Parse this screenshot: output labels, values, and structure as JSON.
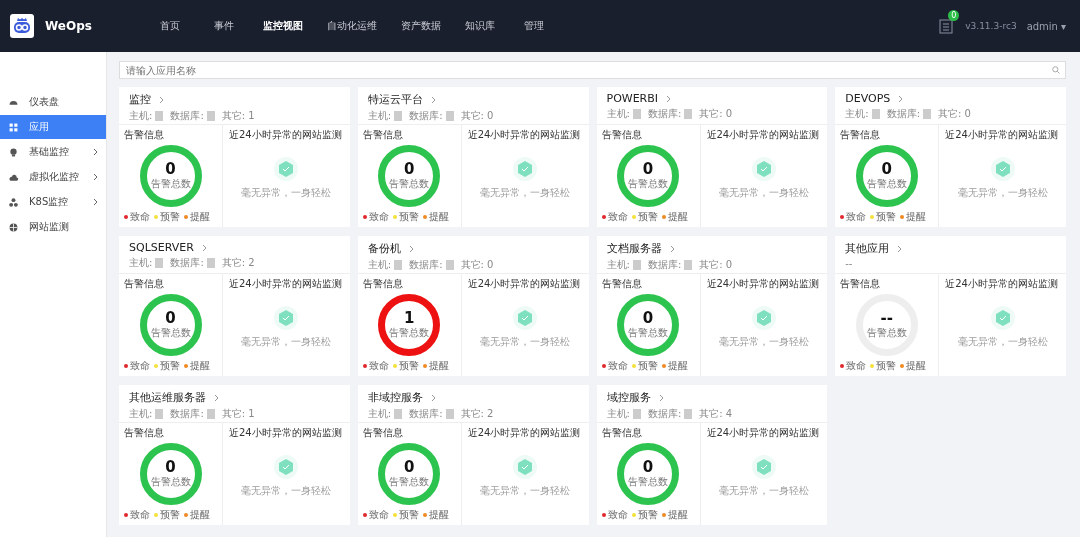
{
  "header": {
    "logo_text": "WeOps",
    "nav": [
      {
        "label": "首页",
        "selected": false
      },
      {
        "label": "事件",
        "selected": false
      },
      {
        "label": "监控视图",
        "selected": true
      },
      {
        "label": "自动化运维",
        "selected": false
      },
      {
        "label": "资产数据",
        "selected": false
      },
      {
        "label": "知识库",
        "selected": false
      },
      {
        "label": "管理",
        "selected": false
      }
    ],
    "notification_badge": "0",
    "version": "v3.11.3-rc3",
    "user": "admin",
    "user_caret": "▾"
  },
  "sidebar": {
    "items": [
      {
        "label": "仪表盘",
        "selected": false,
        "expandable": false
      },
      {
        "label": "应用",
        "selected": true,
        "expandable": false
      },
      {
        "label": "基础监控",
        "selected": false,
        "expandable": true
      },
      {
        "label": "虚拟化监控",
        "selected": false,
        "expandable": true
      },
      {
        "label": "K8S监控",
        "selected": false,
        "expandable": true
      },
      {
        "label": "网站监测",
        "selected": false,
        "expandable": false
      }
    ]
  },
  "search": {
    "placeholder": "请输入应用名称"
  },
  "apps": [
    {
      "name": "监控",
      "host_label": "主机:",
      "database_label": "数据库:",
      "other": "其它: 1",
      "alarm_title": "告警信息",
      "color": "#2cc44e",
      "count": "0",
      "count_caption": "告警总数",
      "legend": [
        {
          "label": "致命",
          "color": "#e0282e"
        },
        {
          "label": "预警",
          "color": "#f5e13c"
        },
        {
          "label": "提醒",
          "color": "#f08a24"
        }
      ],
      "site_title": "近24小时异常的网站监测",
      "site_empty": "毫无异常，一身轻松"
    },
    {
      "name": "特运云平台",
      "host_label": "主机:",
      "database_label": "数据库:",
      "other": "其它: 0",
      "alarm_title": "告警信息",
      "color": "#2cc44e",
      "count": "0",
      "count_caption": "告警总数",
      "legend": [
        {
          "label": "致命",
          "color": "#e0282e"
        },
        {
          "label": "预警",
          "color": "#f5e13c"
        },
        {
          "label": "提醒",
          "color": "#f08a24"
        }
      ],
      "site_title": "近24小时异常的网站监测",
      "site_empty": "毫无异常，一身轻松"
    },
    {
      "name": "POWERBI",
      "host_label": "主机:",
      "database_label": "数据库:",
      "other": "其它: 0",
      "alarm_title": "告警信息",
      "color": "#2cc44e",
      "count": "0",
      "count_caption": "告警总数",
      "legend": [
        {
          "label": "致命",
          "color": "#e0282e"
        },
        {
          "label": "预警",
          "color": "#f5e13c"
        },
        {
          "label": "提醒",
          "color": "#f08a24"
        }
      ],
      "site_title": "近24小时异常的网站监测",
      "site_empty": "毫无异常，一身轻松"
    },
    {
      "name": "DEVOPS",
      "host_label": "主机:",
      "database_label": "数据库:",
      "other": "其它: 0",
      "alarm_title": "告警信息",
      "color": "#2cc44e",
      "count": "0",
      "count_caption": "告警总数",
      "legend": [
        {
          "label": "致命",
          "color": "#e0282e"
        },
        {
          "label": "预警",
          "color": "#f5e13c"
        },
        {
          "label": "提醒",
          "color": "#f08a24"
        }
      ],
      "site_title": "近24小时异常的网站监测",
      "site_empty": "毫无异常，一身轻松"
    },
    {
      "name": "SQLSERVER",
      "host_label": "主机:",
      "database_label": "数据库:",
      "other": "其它: 2",
      "alarm_title": "告警信息",
      "color": "#2cc44e",
      "count": "0",
      "count_caption": "告警总数",
      "legend": [
        {
          "label": "致命",
          "color": "#e0282e"
        },
        {
          "label": "预警",
          "color": "#f5e13c"
        },
        {
          "label": "提醒",
          "color": "#f08a24"
        }
      ],
      "site_title": "近24小时异常的网站监测",
      "site_empty": "毫无异常，一身轻松"
    },
    {
      "name": "备份机",
      "host_label": "主机:",
      "database_label": "数据库:",
      "other": "其它: 0",
      "alarm_title": "告警信息",
      "color": "#ee1111",
      "count": "1",
      "count_caption": "告警总数",
      "legend": [
        {
          "label": "致命",
          "color": "#e0282e"
        },
        {
          "label": "预警",
          "color": "#f5e13c"
        },
        {
          "label": "提醒",
          "color": "#f08a24"
        }
      ],
      "site_title": "近24小时异常的网站监测",
      "site_empty": "毫无异常，一身轻松"
    },
    {
      "name": "文档服务器",
      "host_label": "主机:",
      "database_label": "数据库:",
      "other": "其它: 0",
      "alarm_title": "告警信息",
      "color": "#2cc44e",
      "count": "0",
      "count_caption": "告警总数",
      "legend": [
        {
          "label": "致命",
          "color": "#e0282e"
        },
        {
          "label": "预警",
          "color": "#f5e13c"
        },
        {
          "label": "提醒",
          "color": "#f08a24"
        }
      ],
      "site_title": "近24小时异常的网站监测",
      "site_empty": "毫无异常，一身轻松"
    },
    {
      "name": "其他应用",
      "other": "--",
      "alarm_title": "告警信息",
      "color": "#eeeeee",
      "count": "--",
      "count_caption": "告警总数",
      "legend": [
        {
          "label": "致命",
          "color": "#e0282e"
        },
        {
          "label": "预警",
          "color": "#f5e13c"
        },
        {
          "label": "提醒",
          "color": "#f08a24"
        }
      ],
      "site_title": "近24小时异常的网站监测",
      "site_empty": "毫无异常，一身轻松"
    },
    {
      "name": "其他运维服务器",
      "host_label": "主机:",
      "database_label": "数据库:",
      "other": "其它: 1",
      "alarm_title": "告警信息",
      "color": "#2cc44e",
      "count": "0",
      "count_caption": "告警总数",
      "legend": [
        {
          "label": "致命",
          "color": "#e0282e"
        },
        {
          "label": "预警",
          "color": "#f5e13c"
        },
        {
          "label": "提醒",
          "color": "#f08a24"
        }
      ],
      "site_title": "近24小时异常的网站监测",
      "site_empty": "毫无异常，一身轻松"
    },
    {
      "name": "非域控服务",
      "host_label": "主机:",
      "database_label": "数据库:",
      "other": "其它: 2",
      "alarm_title": "告警信息",
      "color": "#2cc44e",
      "count": "0",
      "count_caption": "告警总数",
      "legend": [
        {
          "label": "致命",
          "color": "#e0282e"
        },
        {
          "label": "预警",
          "color": "#f5e13c"
        },
        {
          "label": "提醒",
          "color": "#f08a24"
        }
      ],
      "site_title": "近24小时异常的网站监测",
      "site_empty": "毫无异常，一身轻松"
    },
    {
      "name": "域控服务",
      "host_label": "主机:",
      "database_label": "数据库:",
      "other": "其它: 4",
      "alarm_title": "告警信息",
      "color": "#2cc44e",
      "count": "0",
      "count_caption": "告警总数",
      "legend": [
        {
          "label": "致命",
          "color": "#e0282e"
        },
        {
          "label": "预警",
          "color": "#f5e13c"
        },
        {
          "label": "提醒",
          "color": "#f08a24"
        }
      ],
      "site_title": "近24小时异常的网站监测",
      "site_empty": "毫无异常，一身轻松"
    }
  ]
}
